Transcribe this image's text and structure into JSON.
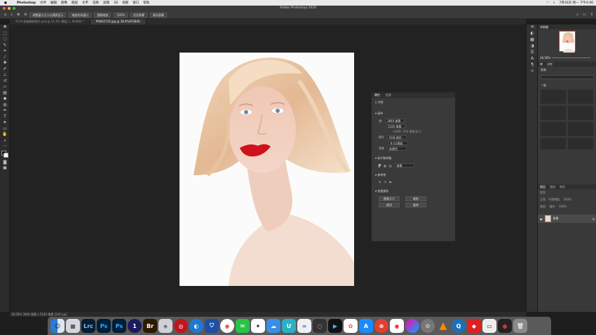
{
  "menubar": {
    "apple": "",
    "app": "Photoshop",
    "items": [
      "文件",
      "编辑",
      "图像",
      "图层",
      "文字",
      "选择",
      "滤镜",
      "3D",
      "视图",
      "窗口",
      "帮助"
    ],
    "clock": "7月26日 周一 下午4:06"
  },
  "window": {
    "title": "Adobe Photoshop 2020"
  },
  "options": {
    "zoom_all": "调整窗口大小以满屏显示",
    "zoom_all_windows": "缩放所有窗口",
    "scrubby": "细微缩放",
    "percent": "100%",
    "fit_screen": "适合屏幕",
    "fill_screen": "填充屏幕"
  },
  "tabs": [
    {
      "label": "5174-欧美精修图片.psd @ 13.3% (图层 1, RGB/8) *"
    },
    {
      "label": "PANA2724.jpg @ 38.6%(RGB/8)"
    }
  ],
  "status": {
    "text": "38.58%  3840 像素 x 5184 像素 (240 ppi)"
  },
  "properties": {
    "tabs": [
      "属性",
      "信息"
    ],
    "doc_label": "文档",
    "canvas_section": "画布",
    "width_value": "3840 像素",
    "height_value": "5184 像素",
    "resolution": "分辨率: 240 像素/英寸",
    "mode_label": "模式",
    "mode_value": "RGB 颜色",
    "bits_value": "8 位/通道",
    "bg_label": "背景",
    "bg_value": "前景色",
    "rulers_section": "标尺和网格",
    "rulers_unit": "像素",
    "guides_section": "参考线",
    "quick_section": "快速操作",
    "btn_image_size": "图像大小",
    "btn_crop": "裁剪",
    "btn_trim": "裁切",
    "btn_rotate": "旋转"
  },
  "navigator": {
    "title": "导航器",
    "zoom": "38.58%"
  },
  "brushes": {
    "tabs": [
      "库",
      "调整"
    ],
    "search": "画笔",
    "group": "一般"
  },
  "layers": {
    "tabs": [
      "图层",
      "通道",
      "路径"
    ],
    "kind": "类型",
    "blend": "正常",
    "opacity_label": "不透明度:",
    "opacity": "100%",
    "lock_label": "锁定:",
    "fill_label": "填充:",
    "fill": "100%",
    "layer_name": "背景"
  },
  "dock": [
    "Finder",
    "Launchpad",
    "Lrc",
    "Ps",
    "Ps",
    "1Password",
    "Br",
    "Preview",
    "Chrome",
    "WeChat",
    "QQ",
    "Music",
    "VLC",
    "Settings"
  ]
}
